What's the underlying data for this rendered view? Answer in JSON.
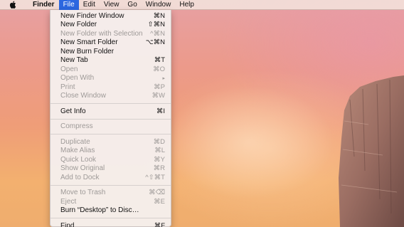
{
  "menubar": {
    "apple_icon": "apple-icon",
    "items": [
      "Finder",
      "File",
      "Edit",
      "View",
      "Go",
      "Window",
      "Help"
    ],
    "active": "File"
  },
  "file_menu": {
    "groups": [
      [
        {
          "label": "New Finder Window",
          "shortcut": "⌘N",
          "enabled": true
        },
        {
          "label": "New Folder",
          "shortcut": "⇧⌘N",
          "enabled": true
        },
        {
          "label": "New Folder with Selection",
          "shortcut": "^⌘N",
          "enabled": false
        },
        {
          "label": "New Smart Folder",
          "shortcut": "⌥⌘N",
          "enabled": true
        },
        {
          "label": "New Burn Folder",
          "shortcut": "",
          "enabled": true
        },
        {
          "label": "New Tab",
          "shortcut": "⌘T",
          "enabled": true
        },
        {
          "label": "Open",
          "shortcut": "⌘O",
          "enabled": false
        },
        {
          "label": "Open With",
          "shortcut": "▸",
          "enabled": false,
          "submenu": true
        },
        {
          "label": "Print",
          "shortcut": "⌘P",
          "enabled": false
        },
        {
          "label": "Close Window",
          "shortcut": "⌘W",
          "enabled": false
        }
      ],
      [
        {
          "label": "Get Info",
          "shortcut": "⌘I",
          "enabled": true
        }
      ],
      [
        {
          "label": "Compress",
          "shortcut": "",
          "enabled": false
        }
      ],
      [
        {
          "label": "Duplicate",
          "shortcut": "⌘D",
          "enabled": false
        },
        {
          "label": "Make Alias",
          "shortcut": "⌘L",
          "enabled": false
        },
        {
          "label": "Quick Look",
          "shortcut": "⌘Y",
          "enabled": false
        },
        {
          "label": "Show Original",
          "shortcut": "⌘R",
          "enabled": false
        },
        {
          "label": "Add to Dock",
          "shortcut": "^⇧⌘T",
          "enabled": false
        }
      ],
      [
        {
          "label": "Move to Trash",
          "shortcut": "⌘⌫",
          "enabled": false
        },
        {
          "label": "Eject",
          "shortcut": "⌘E",
          "enabled": false
        },
        {
          "label": "Burn “Desktop” to Disc…",
          "shortcut": "",
          "enabled": true
        }
      ],
      [
        {
          "label": "Find",
          "shortcut": "⌘F",
          "enabled": true
        }
      ]
    ]
  },
  "colors": {
    "highlight": "#2c67e0",
    "disabled_text": "#9e9a98"
  }
}
